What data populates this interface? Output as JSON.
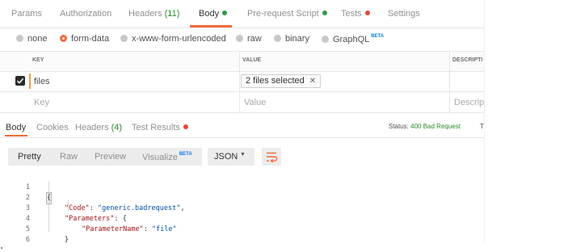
{
  "request_tabs": [
    {
      "label": "Params"
    },
    {
      "label": "Authorization"
    },
    {
      "label": "Headers",
      "count": "(11)"
    },
    {
      "label": "Body",
      "dot_color": "#2c9a48"
    },
    {
      "label": "Pre-request Script",
      "dot_color": "#2c9a48"
    },
    {
      "label": "Tests",
      "dot_color": "#e8453c"
    },
    {
      "label": "Settings"
    }
  ],
  "body_types": {
    "options": [
      "none",
      "form-data",
      "x-www-form-urlencoded",
      "raw",
      "binary",
      "GraphQL"
    ],
    "selected": "form-data",
    "graphql_badge": "BETA"
  },
  "params_table": {
    "headers": {
      "key": "KEY",
      "value": "VALUE",
      "description": "DESCRIPTI"
    },
    "rows": [
      {
        "checked": true,
        "key": "files",
        "value": "2 files selected"
      }
    ],
    "new_row": {
      "key_placeholder": "Key",
      "value_placeholder": "Value",
      "description_placeholder": "Descript"
    }
  },
  "response_tabs": [
    {
      "label": "Body"
    },
    {
      "label": "Cookies"
    },
    {
      "label": "Headers",
      "count": "(4)"
    },
    {
      "label": "Test Results",
      "dot_color": "#e8453c"
    }
  ],
  "status": {
    "label": "Status:",
    "value": "400 Bad Request",
    "more": "T"
  },
  "view_modes": {
    "options": [
      "Pretty",
      "Raw",
      "Preview",
      "Visualize"
    ],
    "active": "Pretty",
    "visualize_badge": "BETA"
  },
  "format": {
    "selected": "JSON"
  },
  "icons": {
    "wrap": "wrap-lines-icon",
    "remove": "close-icon",
    "checkbox": "checkmark-icon",
    "dropdown": "caret-down-icon"
  },
  "colors": {
    "accent": "#f26b3a",
    "success": "#2c8a2c",
    "error": "#e8453c",
    "beta": "#097bed"
  },
  "response_body": {
    "line_numbers": [
      "1",
      "2",
      "3",
      "4",
      "5",
      "6"
    ],
    "lines": [
      {
        "open": "{"
      },
      {
        "key": "\"Code\"",
        "sep": ": ",
        "value": "\"generic.badrequest\"",
        "end": ","
      },
      {
        "key": "\"Parameters\"",
        "sep": ": ",
        "end": "{"
      },
      {
        "key": "\"ParameterName\"",
        "sep": ": ",
        "value": "\"file\""
      },
      {
        "close": "}"
      },
      {
        "close": "}"
      }
    ]
  }
}
